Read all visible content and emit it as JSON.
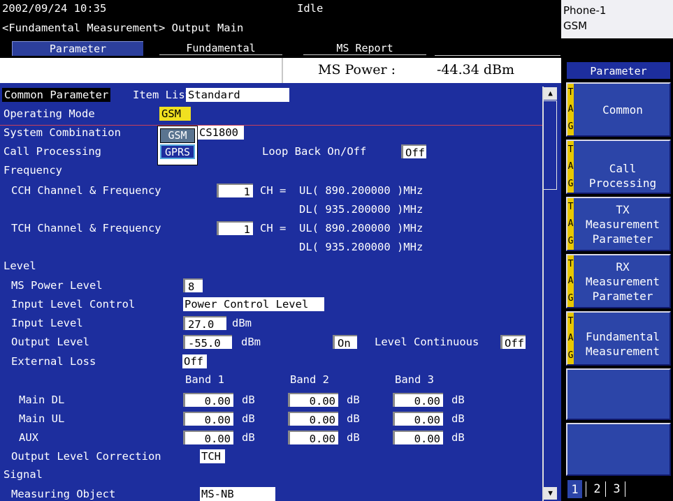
{
  "status": {
    "datetime": "2002/09/24 10:35",
    "state": "Idle",
    "screen_title": "<Fundamental Measurement> Output Main",
    "phone_line1": "Phone-1",
    "phone_line2": "GSM"
  },
  "tabs": [
    "Parameter",
    "Fundamental",
    "MS Report"
  ],
  "infobar": {
    "label": "MS Power :",
    "value": "-44.34 dBm"
  },
  "main": {
    "common_parameter": "Common Parameter",
    "item_list_label": "Item List",
    "item_list_value": "Standard",
    "operating_mode_label": "Operating Mode",
    "operating_mode_value": "GSM",
    "system_combination_label": "System Combination",
    "system_combination_value": "CS1800",
    "call_processing_label": "Call Processing",
    "loopback_label": "Loop Back On/Off",
    "loopback_value": "Off",
    "frequency_label": "Frequency",
    "cch_label": "CCH Channel & Frequency",
    "cch_channel": "1",
    "ch_eq": "CH =",
    "cch_ul": "UL( 890.200000 )MHz",
    "cch_dl": "DL( 935.200000 )MHz",
    "tch_label": "TCH Channel & Frequency",
    "tch_channel": "1",
    "tch_ul": "UL( 890.200000 )MHz",
    "tch_dl": "DL( 935.200000 )MHz",
    "level_label": "Level",
    "ms_power_level_label": "MS Power Level",
    "ms_power_level_value": "8",
    "input_level_control_label": "Input Level Control",
    "input_level_control_value": "Power Control Level",
    "input_level_label": "Input Level",
    "input_level_value": "27.0",
    "output_level_label": "Output Level",
    "output_level_value": "-55.0",
    "dbm": "dBm",
    "output_on": "On",
    "level_continuous_label": "Level Continuous",
    "level_continuous_value": "Off",
    "external_loss_label": "External Loss",
    "external_loss_value": "Off",
    "bands": [
      "Band 1",
      "Band 2",
      "Band 3"
    ],
    "loss_rows": [
      {
        "label": "Main DL",
        "values": [
          "0.00",
          "0.00",
          "0.00"
        ]
      },
      {
        "label": "Main UL",
        "values": [
          "0.00",
          "0.00",
          "0.00"
        ]
      },
      {
        "label": "AUX",
        "values": [
          "0.00",
          "0.00",
          "0.00"
        ]
      }
    ],
    "db": "dB",
    "output_level_correction_label": "Output Level Correction",
    "output_level_correction_value": "TCH",
    "signal_label": "Signal",
    "measuring_object_label": "Measuring Object",
    "measuring_object_value": "MS-NB"
  },
  "popup": {
    "options": [
      "GSM",
      "GPRS"
    ]
  },
  "side": {
    "header": "Parameter",
    "tag": [
      "T",
      "A",
      "G"
    ],
    "keys": [
      [
        "Common"
      ],
      [
        "Call",
        "Processing"
      ],
      [
        "TX",
        "Measurement",
        "Parameter"
      ],
      [
        "RX",
        "Measurement",
        "Parameter"
      ],
      [
        "Fundamental",
        "Measurement"
      ],
      [],
      []
    ],
    "pages": [
      "1",
      "2",
      "3"
    ]
  },
  "colors": {
    "panel_blue": "#1d2e9e",
    "softkey_blue": "#2c45a8",
    "highlight_yellow": "#f0e020",
    "tag_yellow": "#e8c800"
  },
  "icons": {
    "scroll_up": "triangle-up-icon",
    "scroll_down": "triangle-down-icon"
  }
}
